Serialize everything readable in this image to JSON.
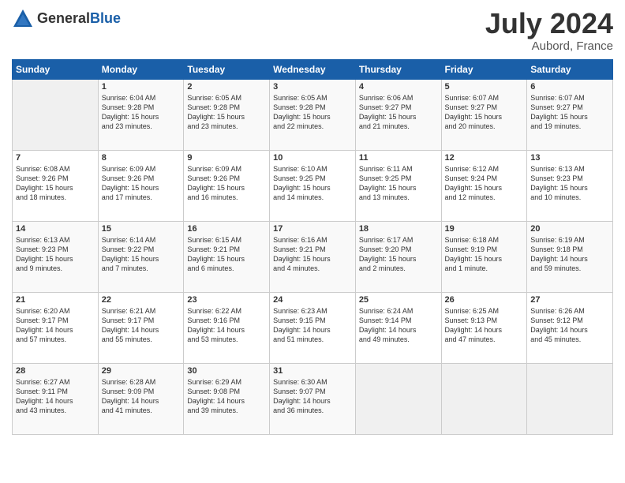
{
  "header": {
    "logo_general": "General",
    "logo_blue": "Blue",
    "month_year": "July 2024",
    "location": "Aubord, France"
  },
  "weekdays": [
    "Sunday",
    "Monday",
    "Tuesday",
    "Wednesday",
    "Thursday",
    "Friday",
    "Saturday"
  ],
  "weeks": [
    [
      {
        "day": "",
        "text": ""
      },
      {
        "day": "1",
        "text": "Sunrise: 6:04 AM\nSunset: 9:28 PM\nDaylight: 15 hours\nand 23 minutes."
      },
      {
        "day": "2",
        "text": "Sunrise: 6:05 AM\nSunset: 9:28 PM\nDaylight: 15 hours\nand 23 minutes."
      },
      {
        "day": "3",
        "text": "Sunrise: 6:05 AM\nSunset: 9:28 PM\nDaylight: 15 hours\nand 22 minutes."
      },
      {
        "day": "4",
        "text": "Sunrise: 6:06 AM\nSunset: 9:27 PM\nDaylight: 15 hours\nand 21 minutes."
      },
      {
        "day": "5",
        "text": "Sunrise: 6:07 AM\nSunset: 9:27 PM\nDaylight: 15 hours\nand 20 minutes."
      },
      {
        "day": "6",
        "text": "Sunrise: 6:07 AM\nSunset: 9:27 PM\nDaylight: 15 hours\nand 19 minutes."
      }
    ],
    [
      {
        "day": "7",
        "text": "Sunrise: 6:08 AM\nSunset: 9:26 PM\nDaylight: 15 hours\nand 18 minutes."
      },
      {
        "day": "8",
        "text": "Sunrise: 6:09 AM\nSunset: 9:26 PM\nDaylight: 15 hours\nand 17 minutes."
      },
      {
        "day": "9",
        "text": "Sunrise: 6:09 AM\nSunset: 9:26 PM\nDaylight: 15 hours\nand 16 minutes."
      },
      {
        "day": "10",
        "text": "Sunrise: 6:10 AM\nSunset: 9:25 PM\nDaylight: 15 hours\nand 14 minutes."
      },
      {
        "day": "11",
        "text": "Sunrise: 6:11 AM\nSunset: 9:25 PM\nDaylight: 15 hours\nand 13 minutes."
      },
      {
        "day": "12",
        "text": "Sunrise: 6:12 AM\nSunset: 9:24 PM\nDaylight: 15 hours\nand 12 minutes."
      },
      {
        "day": "13",
        "text": "Sunrise: 6:13 AM\nSunset: 9:23 PM\nDaylight: 15 hours\nand 10 minutes."
      }
    ],
    [
      {
        "day": "14",
        "text": "Sunrise: 6:13 AM\nSunset: 9:23 PM\nDaylight: 15 hours\nand 9 minutes."
      },
      {
        "day": "15",
        "text": "Sunrise: 6:14 AM\nSunset: 9:22 PM\nDaylight: 15 hours\nand 7 minutes."
      },
      {
        "day": "16",
        "text": "Sunrise: 6:15 AM\nSunset: 9:21 PM\nDaylight: 15 hours\nand 6 minutes."
      },
      {
        "day": "17",
        "text": "Sunrise: 6:16 AM\nSunset: 9:21 PM\nDaylight: 15 hours\nand 4 minutes."
      },
      {
        "day": "18",
        "text": "Sunrise: 6:17 AM\nSunset: 9:20 PM\nDaylight: 15 hours\nand 2 minutes."
      },
      {
        "day": "19",
        "text": "Sunrise: 6:18 AM\nSunset: 9:19 PM\nDaylight: 15 hours\nand 1 minute."
      },
      {
        "day": "20",
        "text": "Sunrise: 6:19 AM\nSunset: 9:18 PM\nDaylight: 14 hours\nand 59 minutes."
      }
    ],
    [
      {
        "day": "21",
        "text": "Sunrise: 6:20 AM\nSunset: 9:17 PM\nDaylight: 14 hours\nand 57 minutes."
      },
      {
        "day": "22",
        "text": "Sunrise: 6:21 AM\nSunset: 9:17 PM\nDaylight: 14 hours\nand 55 minutes."
      },
      {
        "day": "23",
        "text": "Sunrise: 6:22 AM\nSunset: 9:16 PM\nDaylight: 14 hours\nand 53 minutes."
      },
      {
        "day": "24",
        "text": "Sunrise: 6:23 AM\nSunset: 9:15 PM\nDaylight: 14 hours\nand 51 minutes."
      },
      {
        "day": "25",
        "text": "Sunrise: 6:24 AM\nSunset: 9:14 PM\nDaylight: 14 hours\nand 49 minutes."
      },
      {
        "day": "26",
        "text": "Sunrise: 6:25 AM\nSunset: 9:13 PM\nDaylight: 14 hours\nand 47 minutes."
      },
      {
        "day": "27",
        "text": "Sunrise: 6:26 AM\nSunset: 9:12 PM\nDaylight: 14 hours\nand 45 minutes."
      }
    ],
    [
      {
        "day": "28",
        "text": "Sunrise: 6:27 AM\nSunset: 9:11 PM\nDaylight: 14 hours\nand 43 minutes."
      },
      {
        "day": "29",
        "text": "Sunrise: 6:28 AM\nSunset: 9:09 PM\nDaylight: 14 hours\nand 41 minutes."
      },
      {
        "day": "30",
        "text": "Sunrise: 6:29 AM\nSunset: 9:08 PM\nDaylight: 14 hours\nand 39 minutes."
      },
      {
        "day": "31",
        "text": "Sunrise: 6:30 AM\nSunset: 9:07 PM\nDaylight: 14 hours\nand 36 minutes."
      },
      {
        "day": "",
        "text": ""
      },
      {
        "day": "",
        "text": ""
      },
      {
        "day": "",
        "text": ""
      }
    ]
  ]
}
